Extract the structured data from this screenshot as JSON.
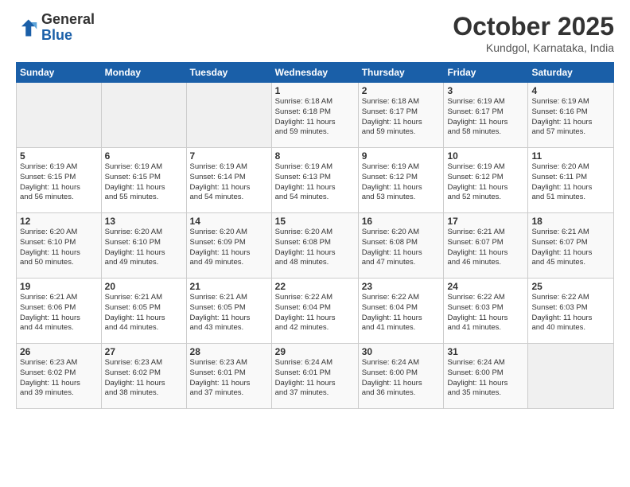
{
  "header": {
    "logo_line1": "General",
    "logo_line2": "Blue",
    "month": "October 2025",
    "location": "Kundgol, Karnataka, India"
  },
  "days_of_week": [
    "Sunday",
    "Monday",
    "Tuesday",
    "Wednesday",
    "Thursday",
    "Friday",
    "Saturday"
  ],
  "weeks": [
    [
      {
        "day": "",
        "info": ""
      },
      {
        "day": "",
        "info": ""
      },
      {
        "day": "",
        "info": ""
      },
      {
        "day": "1",
        "info": "Sunrise: 6:18 AM\nSunset: 6:18 PM\nDaylight: 11 hours\nand 59 minutes."
      },
      {
        "day": "2",
        "info": "Sunrise: 6:18 AM\nSunset: 6:17 PM\nDaylight: 11 hours\nand 59 minutes."
      },
      {
        "day": "3",
        "info": "Sunrise: 6:19 AM\nSunset: 6:17 PM\nDaylight: 11 hours\nand 58 minutes."
      },
      {
        "day": "4",
        "info": "Sunrise: 6:19 AM\nSunset: 6:16 PM\nDaylight: 11 hours\nand 57 minutes."
      }
    ],
    [
      {
        "day": "5",
        "info": "Sunrise: 6:19 AM\nSunset: 6:15 PM\nDaylight: 11 hours\nand 56 minutes."
      },
      {
        "day": "6",
        "info": "Sunrise: 6:19 AM\nSunset: 6:15 PM\nDaylight: 11 hours\nand 55 minutes."
      },
      {
        "day": "7",
        "info": "Sunrise: 6:19 AM\nSunset: 6:14 PM\nDaylight: 11 hours\nand 54 minutes."
      },
      {
        "day": "8",
        "info": "Sunrise: 6:19 AM\nSunset: 6:13 PM\nDaylight: 11 hours\nand 54 minutes."
      },
      {
        "day": "9",
        "info": "Sunrise: 6:19 AM\nSunset: 6:12 PM\nDaylight: 11 hours\nand 53 minutes."
      },
      {
        "day": "10",
        "info": "Sunrise: 6:19 AM\nSunset: 6:12 PM\nDaylight: 11 hours\nand 52 minutes."
      },
      {
        "day": "11",
        "info": "Sunrise: 6:20 AM\nSunset: 6:11 PM\nDaylight: 11 hours\nand 51 minutes."
      }
    ],
    [
      {
        "day": "12",
        "info": "Sunrise: 6:20 AM\nSunset: 6:10 PM\nDaylight: 11 hours\nand 50 minutes."
      },
      {
        "day": "13",
        "info": "Sunrise: 6:20 AM\nSunset: 6:10 PM\nDaylight: 11 hours\nand 49 minutes."
      },
      {
        "day": "14",
        "info": "Sunrise: 6:20 AM\nSunset: 6:09 PM\nDaylight: 11 hours\nand 49 minutes."
      },
      {
        "day": "15",
        "info": "Sunrise: 6:20 AM\nSunset: 6:08 PM\nDaylight: 11 hours\nand 48 minutes."
      },
      {
        "day": "16",
        "info": "Sunrise: 6:20 AM\nSunset: 6:08 PM\nDaylight: 11 hours\nand 47 minutes."
      },
      {
        "day": "17",
        "info": "Sunrise: 6:21 AM\nSunset: 6:07 PM\nDaylight: 11 hours\nand 46 minutes."
      },
      {
        "day": "18",
        "info": "Sunrise: 6:21 AM\nSunset: 6:07 PM\nDaylight: 11 hours\nand 45 minutes."
      }
    ],
    [
      {
        "day": "19",
        "info": "Sunrise: 6:21 AM\nSunset: 6:06 PM\nDaylight: 11 hours\nand 44 minutes."
      },
      {
        "day": "20",
        "info": "Sunrise: 6:21 AM\nSunset: 6:05 PM\nDaylight: 11 hours\nand 44 minutes."
      },
      {
        "day": "21",
        "info": "Sunrise: 6:21 AM\nSunset: 6:05 PM\nDaylight: 11 hours\nand 43 minutes."
      },
      {
        "day": "22",
        "info": "Sunrise: 6:22 AM\nSunset: 6:04 PM\nDaylight: 11 hours\nand 42 minutes."
      },
      {
        "day": "23",
        "info": "Sunrise: 6:22 AM\nSunset: 6:04 PM\nDaylight: 11 hours\nand 41 minutes."
      },
      {
        "day": "24",
        "info": "Sunrise: 6:22 AM\nSunset: 6:03 PM\nDaylight: 11 hours\nand 41 minutes."
      },
      {
        "day": "25",
        "info": "Sunrise: 6:22 AM\nSunset: 6:03 PM\nDaylight: 11 hours\nand 40 minutes."
      }
    ],
    [
      {
        "day": "26",
        "info": "Sunrise: 6:23 AM\nSunset: 6:02 PM\nDaylight: 11 hours\nand 39 minutes."
      },
      {
        "day": "27",
        "info": "Sunrise: 6:23 AM\nSunset: 6:02 PM\nDaylight: 11 hours\nand 38 minutes."
      },
      {
        "day": "28",
        "info": "Sunrise: 6:23 AM\nSunset: 6:01 PM\nDaylight: 11 hours\nand 37 minutes."
      },
      {
        "day": "29",
        "info": "Sunrise: 6:24 AM\nSunset: 6:01 PM\nDaylight: 11 hours\nand 37 minutes."
      },
      {
        "day": "30",
        "info": "Sunrise: 6:24 AM\nSunset: 6:00 PM\nDaylight: 11 hours\nand 36 minutes."
      },
      {
        "day": "31",
        "info": "Sunrise: 6:24 AM\nSunset: 6:00 PM\nDaylight: 11 hours\nand 35 minutes."
      },
      {
        "day": "",
        "info": ""
      }
    ]
  ]
}
